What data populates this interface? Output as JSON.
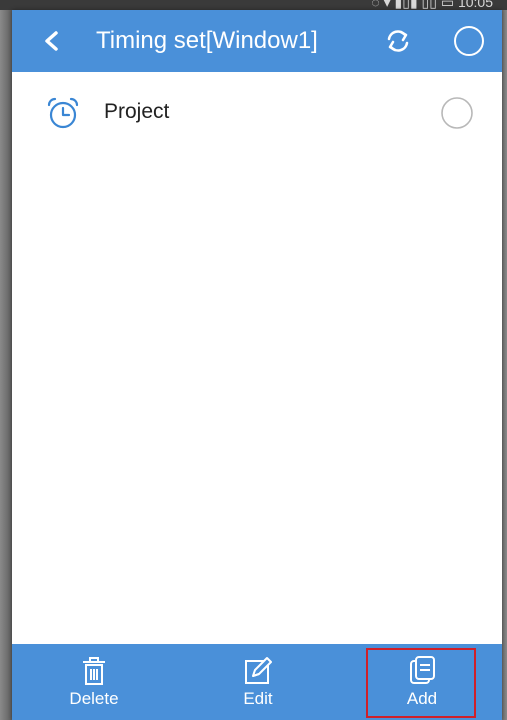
{
  "statusbar": {
    "text": "◌ ▾ ▮▯▮ ▯▯ ▭ 10:05"
  },
  "header": {
    "title": "Timing set[Window1]",
    "back_icon": "chevron-left-icon",
    "refresh_icon": "refresh-icon",
    "select_icon": "radio-circle-icon"
  },
  "list": {
    "items": [
      {
        "label": "Project",
        "icon": "alarm-clock-icon",
        "checked": false
      }
    ]
  },
  "toolbar": {
    "delete_label": "Delete",
    "edit_label": "Edit",
    "add_label": "Add"
  },
  "colors": {
    "primary": "#4a90d9",
    "highlight": "#d0202a",
    "icon_blue": "#3a86d4"
  }
}
